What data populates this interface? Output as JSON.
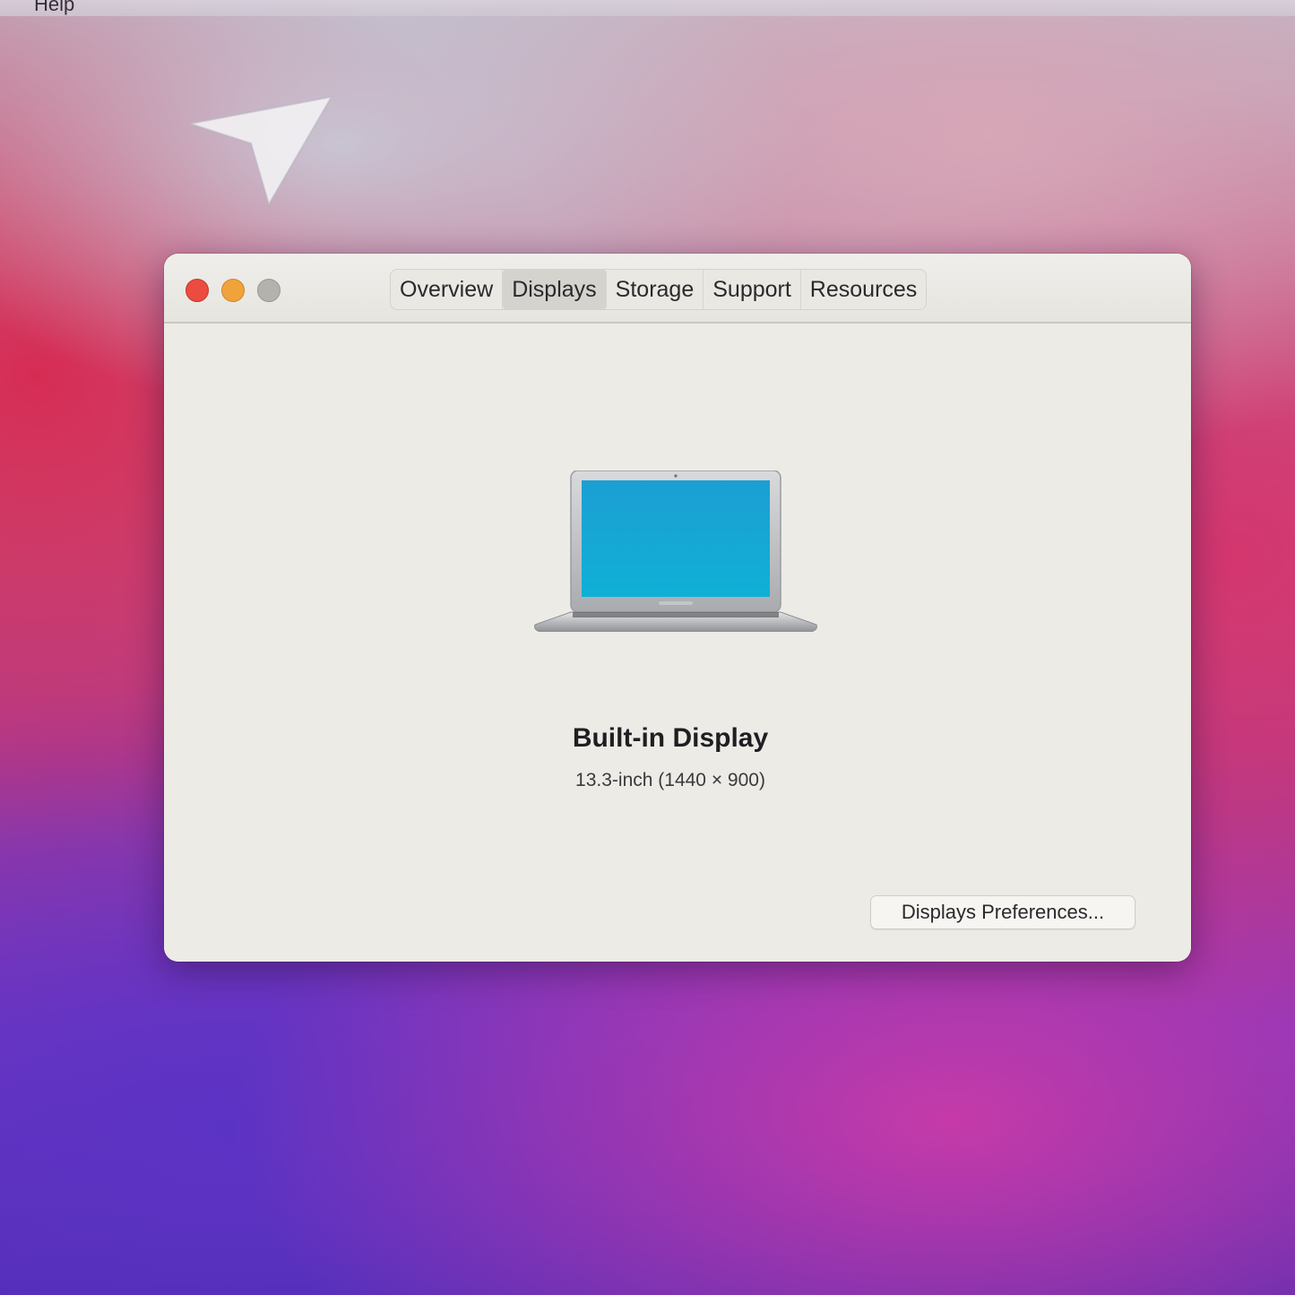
{
  "menubar": {
    "label": "Help"
  },
  "window": {
    "traffic_lights": {
      "close_color": "#ec4b3f",
      "minimize_color": "#f1a33b",
      "zoom_color": "#b3b2ad"
    },
    "tabs": [
      {
        "label": "Overview",
        "active": false
      },
      {
        "label": "Displays",
        "active": true
      },
      {
        "label": "Storage",
        "active": false
      },
      {
        "label": "Support",
        "active": false
      },
      {
        "label": "Resources",
        "active": false
      }
    ],
    "display": {
      "icon": "laptop-icon",
      "name": "Built-in Display",
      "size": "13.3-inch (1440 × 900)"
    },
    "preferences_button": "Displays Preferences..."
  }
}
